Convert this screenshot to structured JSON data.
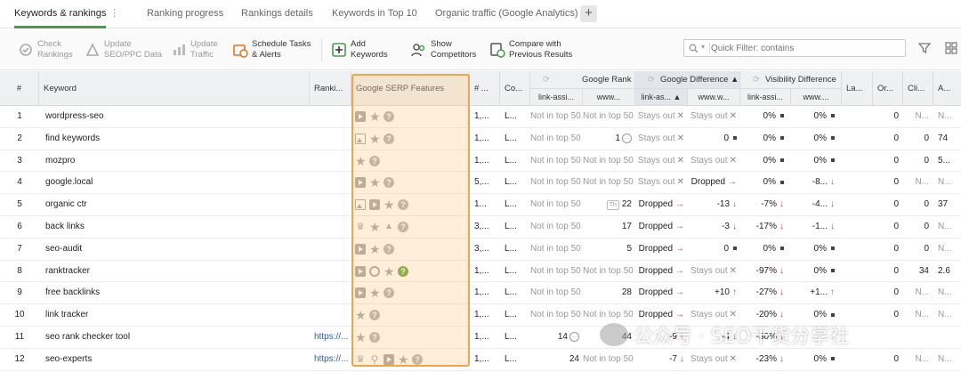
{
  "tabs": [
    {
      "label": "Keywords & rankings",
      "active": true
    },
    {
      "label": "Ranking progress"
    },
    {
      "label": "Rankings details"
    },
    {
      "label": "Keywords in Top 10"
    },
    {
      "label": "Organic traffic (Google Analytics)"
    }
  ],
  "tab_menu": "⋮",
  "tab_add": "+",
  "toolbar": {
    "check": {
      "line1": "Check",
      "line2": "Rankings"
    },
    "update_seo": {
      "line1": "Update",
      "line2": "SEO/PPC Data"
    },
    "update_traffic": {
      "line1": "Update",
      "line2": "Traffic"
    },
    "schedule": {
      "line1": "Schedule Tasks",
      "line2": "& Alerts"
    },
    "add": {
      "line1": "Add",
      "line2": "Keywords"
    },
    "competitors": {
      "line1": "Show",
      "line2": "Competitors"
    },
    "compare": {
      "line1": "Compare with",
      "line2": "Previous Results"
    }
  },
  "search": {
    "placeholder": "Quick Filter: contains"
  },
  "headers": {
    "num": "#",
    "keyword": "Keyword",
    "ranking": "Ranki...",
    "serp": "Google SERP Features",
    "hash2": "# ...",
    "co": "Co...",
    "google_rank": "Google Rank",
    "google_diff": "Google Difference ▲",
    "visibility_diff": "Visibility Difference",
    "la": "La...",
    "or": "Or...",
    "cl": "Cli...",
    "a": "A...",
    "sub_link1": "link-assi...",
    "sub_www1": "www...",
    "sub_link2": "link-as... ▲",
    "sub_www2": "www.w...",
    "sub_link3": "link-assi...",
    "sub_www3": "www...."
  },
  "rows": [
    {
      "n": "1",
      "kw": "wordpress-seo",
      "url": "",
      "feat": [
        "play",
        "star",
        "q"
      ],
      "sv": "1,...",
      "co": "L...",
      "gr1": "Not in top 50",
      "gr2": "Not in top 50",
      "gd1": "Stays out",
      "gd1x": "✕",
      "gd2": "Stays out",
      "gd2x": "✕",
      "v1": "0%",
      "v1s": "sq",
      "v2": "0%",
      "v2s": "sq",
      "la": "",
      "or": "0",
      "cl": "N...",
      "a": "N..."
    },
    {
      "n": "2",
      "kw": "find keywords",
      "url": "",
      "feat": [
        "img",
        "star",
        "q"
      ],
      "sv": "1,...",
      "co": "L...",
      "gr1": "Not in top 50",
      "gr2": "1",
      "gd1": "Stays out",
      "gd1x": "✕",
      "gd2": "0",
      "gd2x": "sq",
      "v1": "0%",
      "v1s": "sq",
      "v2": "0%",
      "v2s": "sq",
      "la": "",
      "or": "0",
      "cl": "0",
      "a": "74"
    },
    {
      "n": "3",
      "kw": "mozpro",
      "url": "",
      "feat": [
        "star",
        "q"
      ],
      "sv": "1,...",
      "co": "L...",
      "gr1": "Not in top 50",
      "gr2": "Not in top 50",
      "gd1": "Stays out",
      "gd1x": "✕",
      "gd2": "Stays out",
      "gd2x": "✕",
      "v1": "0%",
      "v1s": "sq",
      "v2": "0%",
      "v2s": "sq",
      "la": "",
      "or": "0",
      "cl": "0",
      "a": "5..."
    },
    {
      "n": "4",
      "kw": "google.local",
      "url": "",
      "feat": [
        "play",
        "star",
        "q"
      ],
      "sv": "5,...",
      "co": "L...",
      "gr1": "Not in top 50",
      "gr2": "Not in top 50",
      "gd1": "Stays out",
      "gd1x": "✕",
      "gd2": "Dropped",
      "gd2x": "→",
      "v1": "0%",
      "v1s": "sq",
      "v2": "-8...",
      "v2s": "↓",
      "la": "",
      "or": "0",
      "cl": "N...",
      "a": "N..."
    },
    {
      "n": "5",
      "kw": "organic ctr",
      "url": "",
      "feat": [
        "img",
        "play",
        "star",
        "q"
      ],
      "sv": "1...",
      "co": "L...",
      "gr1": "Not in top 50",
      "gr2": "22",
      "gd1": "Dropped",
      "gd1x": "→",
      "gd2": "-13",
      "gd2x": "↓",
      "v1": "-7%",
      "v1s": "↓",
      "v2": "-4...",
      "v2s": "↓",
      "la": "",
      "or": "0",
      "cl": "0",
      "a": "37"
    },
    {
      "n": "6",
      "kw": "back links",
      "url": "",
      "feat": [
        "crown",
        "star",
        "hat",
        "q"
      ],
      "sv": "3,...",
      "co": "L...",
      "gr1": "Not in top 50",
      "gr2": "17",
      "gd1": "Dropped",
      "gd1x": "→",
      "gd2": "-3",
      "gd2x": "↓",
      "v1": "-17%",
      "v1s": "↓",
      "v2": "-1...",
      "v2s": "↓",
      "la": "",
      "or": "0",
      "cl": "0",
      "a": "N..."
    },
    {
      "n": "7",
      "kw": "seo-audit",
      "url": "",
      "feat": [
        "play",
        "star",
        "q"
      ],
      "sv": "3,...",
      "co": "L...",
      "gr1": "Not in top 50",
      "gr2": "5",
      "gd1": "Dropped",
      "gd1x": "→",
      "gd2": "0",
      "gd2x": "sq",
      "v1": "0%",
      "v1s": "sq",
      "v2": "0%",
      "v2s": "sq",
      "la": "",
      "or": "0",
      "cl": "0",
      "a": "N..."
    },
    {
      "n": "8",
      "kw": "ranktracker",
      "url": "",
      "feat": [
        "play",
        "circ",
        "star",
        "qg"
      ],
      "sv": "1,...",
      "co": "L...",
      "gr1": "Not in top 50",
      "gr2": "Not in top 50",
      "gd1": "Dropped",
      "gd1x": "→",
      "gd2": "Stays out",
      "gd2x": "✕",
      "v1": "-97%",
      "v1s": "↓",
      "v2": "0%",
      "v2s": "sq",
      "la": "",
      "or": "0",
      "cl": "34",
      "a": "2.6"
    },
    {
      "n": "9",
      "kw": "free backlinks",
      "url": "",
      "feat": [
        "play",
        "star",
        "q"
      ],
      "sv": "1,...",
      "co": "L...",
      "gr1": "Not in top 50",
      "gr2": "28",
      "gd1": "Dropped",
      "gd1x": "→",
      "gd2": "+10",
      "gd2x": "↑",
      "v1": "-27%",
      "v1s": "↓",
      "v2": "+1...",
      "v2s": "↑",
      "la": "",
      "or": "0",
      "cl": "N...",
      "a": "N..."
    },
    {
      "n": "10",
      "kw": "link tracker",
      "url": "",
      "feat": [
        "star",
        "q"
      ],
      "sv": "1,...",
      "co": "L...",
      "gr1": "Not in top 50",
      "gr2": "Not in top 50",
      "gd1": "Dropped",
      "gd1x": "→",
      "gd2": "Stays out",
      "gd2x": "✕",
      "v1": "-20%",
      "v1s": "↓",
      "v2": "0%",
      "v2s": "sq",
      "la": "",
      "or": "0",
      "cl": "N...",
      "a": "N..."
    },
    {
      "n": "11",
      "kw": "seo rank checker tool",
      "url": "https://...",
      "feat": [
        "star",
        "q"
      ],
      "sv": "1,...",
      "co": "L...",
      "gr1": "14",
      "gr2": "44",
      "gd1": "-9",
      "gd1x": "↓",
      "gd2": "-4",
      "gd2x": "↓",
      "v1": "-30%",
      "v1s": "↓",
      "v2": "-",
      "v2s": "",
      "la": "",
      "or": "",
      "cl": "",
      "a": ""
    },
    {
      "n": "12",
      "kw": "seo-experts",
      "url": "https://...",
      "feat": [
        "crown",
        "pin",
        "play",
        "star",
        "q"
      ],
      "sv": "1,...",
      "co": "L...",
      "gr1": "24",
      "gr2": "Not in top 50",
      "gd1": "-7",
      "gd1x": "↓",
      "gd2": "Stays out",
      "gd2x": "✕",
      "v1": "-23%",
      "v1s": "↓",
      "v2": "0%",
      "v2s": "sq",
      "la": "",
      "or": "0",
      "cl": "N...",
      "a": "N..."
    }
  ],
  "row2_snippet": "…",
  "row5_snippet": "Th",
  "row11_snippet": "…",
  "watermark": "公众号 · SEO干货分享社",
  "colors": {
    "accent": "#43a047",
    "highlight_border": "#f0a44d",
    "down": "#e53935",
    "up": "#43a047"
  }
}
